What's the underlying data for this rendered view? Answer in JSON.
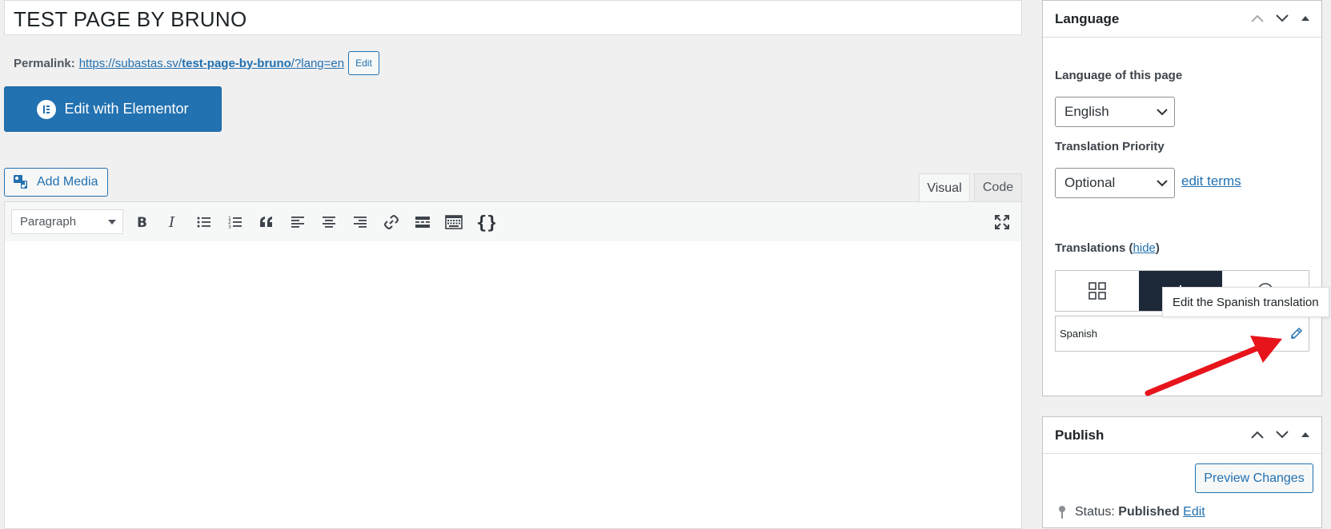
{
  "editor": {
    "title": "TEST PAGE BY BRUNO",
    "permalink_label": "Permalink:",
    "permalink_base": "https://subastas.sv/",
    "permalink_slug": "test-page-by-bruno",
    "permalink_suffix": "/?lang=en",
    "permalink_edit": "Edit",
    "elementor_button": "Edit with Elementor",
    "add_media": "Add Media",
    "tabs": {
      "visual": "Visual",
      "code": "Code"
    },
    "format_select": "Paragraph",
    "toolbar_icons": [
      "bold-icon",
      "italic-icon",
      "bullet-list-icon",
      "numbered-list-icon",
      "blockquote-icon",
      "align-left-icon",
      "align-center-icon",
      "align-right-icon",
      "link-icon",
      "read-more-icon",
      "keyboard-icon",
      "code-braces-icon",
      "fullscreen-icon"
    ]
  },
  "language_panel": {
    "title": "Language",
    "language_label": "Language of this page",
    "language_value": "English",
    "priority_label": "Translation Priority",
    "priority_value": "Optional",
    "edit_terms": "edit terms",
    "translations_label": "Translations (",
    "translations_hide": "hide",
    "translations_close": ")",
    "translation_language": "Spanish",
    "tooltip": "Edit the Spanish translation"
  },
  "publish_panel": {
    "title": "Publish",
    "preview_button": "Preview Changes",
    "status_label": "Status:",
    "status_value": "Published",
    "status_edit": "Edit"
  },
  "colors": {
    "accent": "#2271b1",
    "dark_tab": "#1d2939",
    "annotation_arrow": "#e8141c",
    "background": "#f0f0f1"
  }
}
